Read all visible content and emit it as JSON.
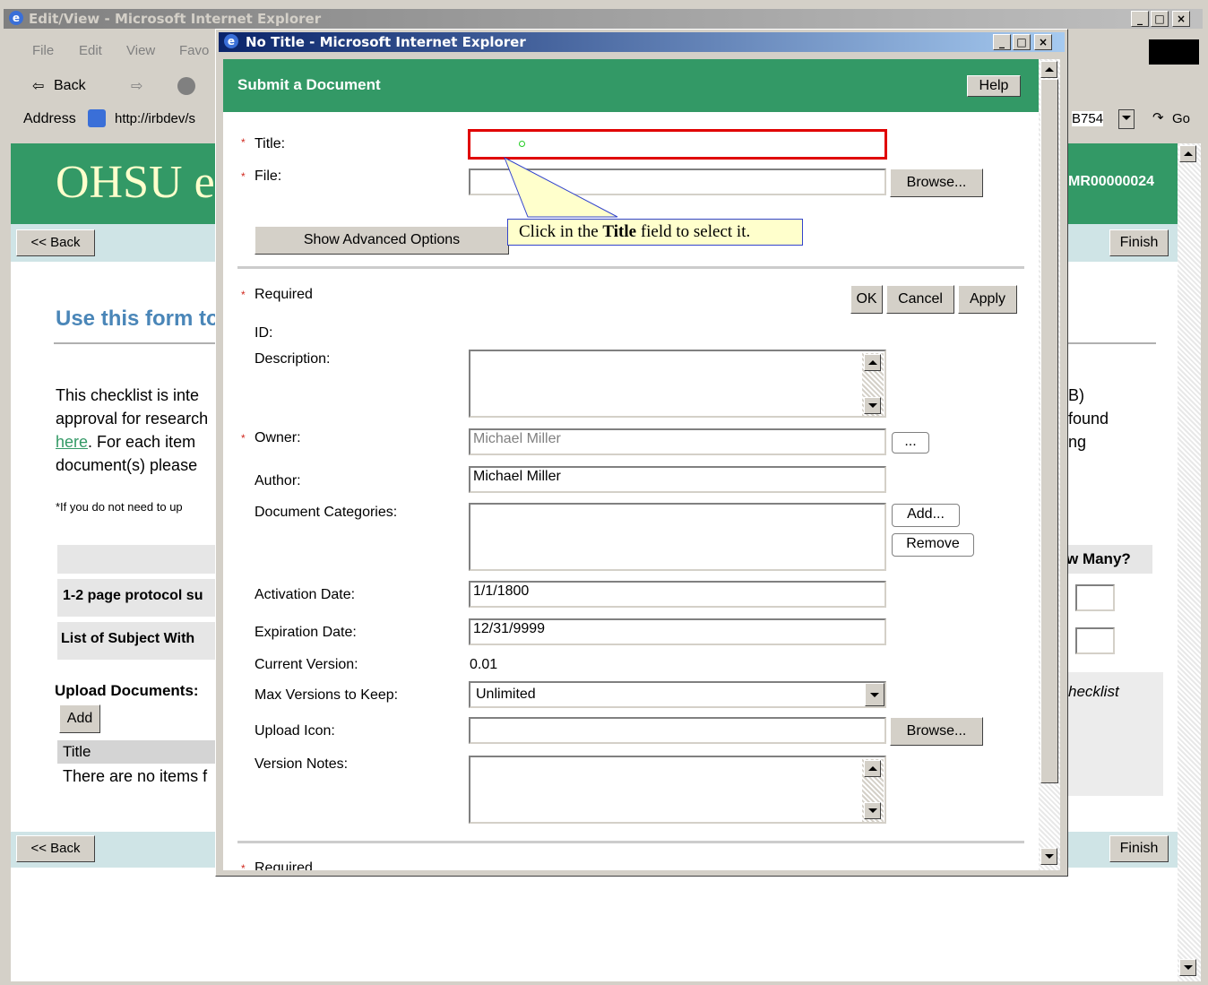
{
  "outer_window": {
    "title": "Edit/View - Microsoft Internet Explorer",
    "menu": [
      "File",
      "Edit",
      "View",
      "Favo"
    ],
    "nav": {
      "back": "Back"
    },
    "address_label": "Address",
    "address_value": "http://irbdev/s",
    "address_suffix": "B754",
    "go": "Go"
  },
  "page": {
    "logo": "OHSU e",
    "record_id": "MR00000024",
    "back": "<< Back",
    "finish": "Finish",
    "heading": "Use this form to",
    "para_left_1": "This checklist is inte",
    "para_left_2": "approval for research",
    "para_left_link": "here",
    "para_left_3": ".  For each item",
    "para_left_4": "document(s) please",
    "para_right_1": "B)",
    "para_right_2": "found",
    "para_right_3": "ng",
    "footnote": "*If you do not need to up",
    "how_many": "w Many?",
    "row1": "1-2 page protocol su",
    "row2": "List of Subject With",
    "upload_docs": "Upload Documents:",
    "add": "Add",
    "title_col": "Title",
    "no_items": "There are no items f",
    "checklist": "hecklist"
  },
  "dialog": {
    "window_title": "No Title - Microsoft Internet Explorer",
    "header": "Submit a Document",
    "help": "Help",
    "title_label": "Title:",
    "file_label": "File:",
    "browse": "Browse...",
    "show_advanced": "Show Advanced Options",
    "tooltip_pre": "Click in the ",
    "tooltip_bold": "Title",
    "tooltip_post": " field to select it.",
    "required": "Required",
    "ok": "OK",
    "cancel": "Cancel",
    "apply": "Apply",
    "id_label": "ID:",
    "description_label": "Description:",
    "owner_label": "Owner:",
    "owner_value": "Michael Miller",
    "owner_picker": "...",
    "author_label": "Author:",
    "author_value": "Michael Miller",
    "doc_categories_label": "Document Categories:",
    "add_btn": "Add...",
    "remove_btn": "Remove",
    "activation_label": "Activation Date:",
    "activation_value": "1/1/1800",
    "expiration_label": "Expiration Date:",
    "expiration_value": "12/31/9999",
    "current_version_label": "Current Version:",
    "current_version_value": "0.01",
    "max_versions_label": "Max Versions to Keep:",
    "max_versions_value": "Unlimited",
    "upload_icon_label": "Upload Icon:",
    "version_notes_label": "Version Notes:",
    "required_bottom": "Required",
    "colors": {
      "green": "#339966",
      "tooltip": "#ffffcc",
      "red_focus": "#e00000"
    }
  }
}
